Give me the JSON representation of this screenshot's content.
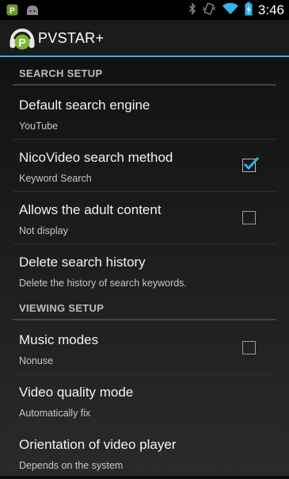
{
  "status_bar": {
    "time": "3:46",
    "left_icons": [
      "app-notification-icon",
      "android-debug-icon"
    ],
    "right_icons": [
      "bluetooth-icon",
      "vibrate-icon",
      "wifi-icon",
      "battery-charging-icon"
    ]
  },
  "action_bar": {
    "title": "PVSTAR+",
    "accent": "#33b5e5"
  },
  "sections": [
    {
      "label": "SEARCH SETUP",
      "items": [
        {
          "title": "Default search engine",
          "summary": "YouTube",
          "control": "none"
        },
        {
          "title": "NicoVideo search method",
          "summary": "Keyword Search",
          "control": "checkbox",
          "checked": true
        },
        {
          "title": "Allows the adult content",
          "summary": "Not display",
          "control": "checkbox",
          "checked": false
        },
        {
          "title": "Delete search history",
          "summary": "Delete the history of search keywords.",
          "control": "none"
        }
      ]
    },
    {
      "label": "VIEWING SETUP",
      "items": [
        {
          "title": "Music modes",
          "summary": "Nonuse",
          "control": "checkbox",
          "checked": false
        },
        {
          "title": "Video quality mode",
          "summary": "Automatically fix",
          "control": "none"
        },
        {
          "title": "Orientation of video player",
          "summary": "Depends on the system",
          "control": "none"
        }
      ]
    }
  ]
}
